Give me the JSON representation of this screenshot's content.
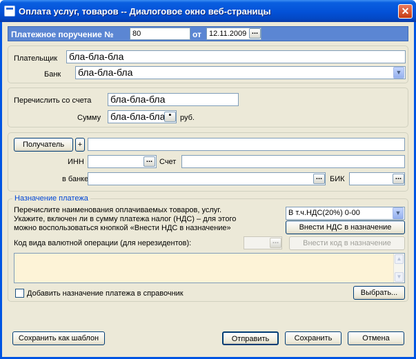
{
  "window": {
    "title": "Оплата услуг, товаров -- Диалоговое окно веб-страницы",
    "close_symbol": "✕"
  },
  "order": {
    "label": "Платежное поручение №",
    "number": "80",
    "date_label": "от",
    "date": "12.11.2009"
  },
  "payer": {
    "payer_label": "Плательщик",
    "payer_value": "бла-бла-бла",
    "bank_label": "Банк",
    "bank_value": "бла-бла-бла"
  },
  "transfer": {
    "account_label": "Перечислить со счета",
    "account_value": "бла-бла-бла",
    "sum_label": "Сумму",
    "sum_value": "бла-бла-бла",
    "currency": "руб."
  },
  "recipient": {
    "recipient_button": "Получатель",
    "plus_button": "+",
    "inn_label": "ИНН",
    "account_label": "Счет",
    "bank_label": "в банке",
    "bik_label": "БИК"
  },
  "purpose": {
    "legend": "Назначение платежа",
    "hint": [
      "Перечислите наименования оплачиваемых товаров, услуг.",
      "Укажите, включен ли в сумму платежа налог (НДС) – для этого",
      "можно воспользоваться кнопкой «Внести НДС в назначение»"
    ],
    "vat_select": "В т.ч.НДС(20%) 0-00",
    "vat_button": "Внести НДС в назначение",
    "currency_op_label": "Код вида валютной операции (для нерезидентов):",
    "code_button": "Внести код в назначение",
    "add_to_directory_label": "Добавить назначение платежа в справочник",
    "choose_button": "Выбрать..."
  },
  "footer": {
    "save_template": "Сохранить как шаблон",
    "send": "Отправить",
    "save": "Сохранить",
    "cancel": "Отмена"
  },
  "colors": {
    "titlebar": "#0351d7",
    "header_bar": "#5b86d3",
    "legend": "#0046d5",
    "textarea_bg": "#fdf3d7"
  }
}
